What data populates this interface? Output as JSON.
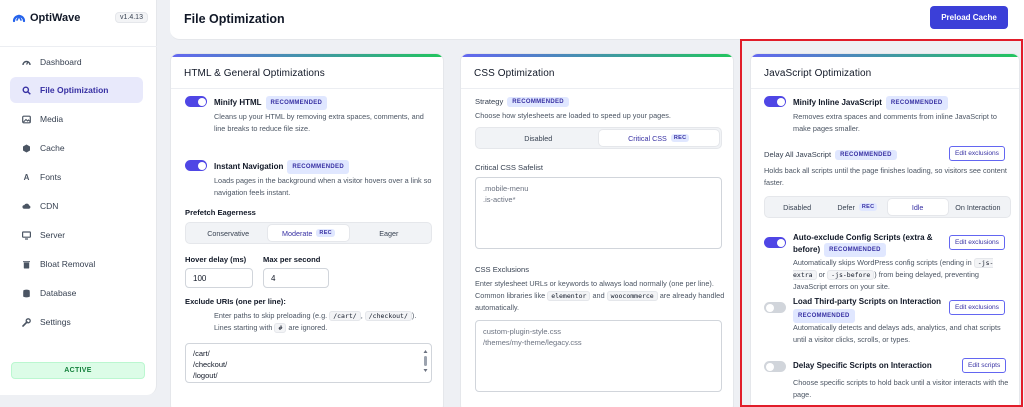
{
  "app": {
    "name": "OptiWave",
    "version": "v1.4.13"
  },
  "sidebar": {
    "items": [
      {
        "label": "Dashboard",
        "icon": "dashboard-icon"
      },
      {
        "label": "File Optimization",
        "icon": "search-icon",
        "active": true
      },
      {
        "label": "Media",
        "icon": "image-icon"
      },
      {
        "label": "Cache",
        "icon": "cache-icon"
      },
      {
        "label": "Fonts",
        "icon": "font-icon"
      },
      {
        "label": "CDN",
        "icon": "cloud-icon"
      },
      {
        "label": "Server",
        "icon": "monitor-icon"
      },
      {
        "label": "Bloat Removal",
        "icon": "trash-icon"
      },
      {
        "label": "Database",
        "icon": "database-icon"
      },
      {
        "label": "Settings",
        "icon": "wrench-icon"
      }
    ],
    "status": "ACTIVE"
  },
  "header": {
    "title": "File Optimization",
    "preload_button": "Preload Cache"
  },
  "html_card": {
    "title": "HTML & General Optimizations",
    "minify": {
      "title": "Minify HTML",
      "badge": "RECOMMENDED",
      "enabled": true,
      "desc": "Cleans up your HTML by removing extra spaces, comments, and line breaks to reduce file size."
    },
    "instant_nav": {
      "title": "Instant Navigation",
      "badge": "RECOMMENDED",
      "enabled": true,
      "desc": "Loads pages in the background when a visitor hovers over a link so navigation feels instant."
    },
    "prefetch": {
      "label": "Prefetch Eagerness",
      "options": [
        "Conservative",
        "Moderate",
        "Eager"
      ],
      "selected": "Moderate",
      "rec_badge": "REC"
    },
    "hover_delay": {
      "label": "Hover delay (ms)",
      "value": "100"
    },
    "max_per_second": {
      "label": "Max per second",
      "value": "4"
    },
    "exclude": {
      "label": "Exclude URIs (one per line):",
      "desc_pre": "Enter paths to skip preloading (e.g.",
      "code1": "/cart/",
      "comma": ",",
      "code2": "/checkout/",
      "desc_mid": "). Lines starting with",
      "code3": "#",
      "desc_post": "are ignored.",
      "value": "/cart/\n/checkout/\n/logout/"
    }
  },
  "css_card": {
    "title": "CSS Optimization",
    "strategy": {
      "label": "Strategy",
      "badge": "RECOMMENDED",
      "desc": "Choose how stylesheets are loaded to speed up your pages.",
      "options": [
        "Disabled",
        "Critical CSS"
      ],
      "selected": "Critical CSS",
      "rec_badge": "REC"
    },
    "safelist": {
      "label": "Critical CSS Safelist",
      "placeholder": ".mobile-menu\n.is-active*"
    },
    "exclusions": {
      "label": "CSS Exclusions",
      "desc_pre": "Enter stylesheet URLs or keywords to always load normally (one per line). Common libraries like",
      "code1": "elementor",
      "and": "and",
      "code2": "woocommerce",
      "desc_post": "are already handled automatically.",
      "placeholder": "custom-plugin-style.css\n/themes/my-theme/legacy.css"
    }
  },
  "js_card": {
    "title": "JavaScript Optimization",
    "minify_inline": {
      "title": "Minify Inline JavaScript",
      "badge": "RECOMMENDED",
      "enabled": true,
      "desc": "Removes extra spaces and comments from inline JavaScript to make pages smaller."
    },
    "delay_all": {
      "title": "Delay All JavaScript",
      "badge": "RECOMMENDED",
      "button": "Edit exclusions",
      "desc": "Holds back all scripts until the page finishes loading, so visitors see content faster.",
      "options": [
        "Disabled",
        "Defer",
        "Idle",
        "On Interaction"
      ],
      "selected": "Idle",
      "rec_badge": "REC"
    },
    "auto_exclude": {
      "title_line1": "Auto-exclude Config Scripts (extra &",
      "title_line2": "before)",
      "badge": "RECOMMENDED",
      "enabled": true,
      "button": "Edit exclusions",
      "desc_pre": "Automatically skips WordPress config scripts (ending in",
      "code1": "-js-extra",
      "or": "or",
      "code2": "-js-before",
      "desc_post": ") from being delayed, preventing JavaScript errors on your site."
    },
    "third_party": {
      "title": "Load Third-party Scripts on Interaction",
      "badge": "RECOMMENDED",
      "enabled": false,
      "button": "Edit exclusions",
      "desc": "Automatically detects and delays ads, analytics, and chat scripts until a visitor clicks, scrolls, or types."
    },
    "delay_specific": {
      "title": "Delay Specific Scripts on Interaction",
      "enabled": false,
      "button": "Edit scripts",
      "desc": "Choose specific scripts to hold back until a visitor interacts with the page."
    }
  },
  "colors": {
    "accent": "#4f46e5",
    "button": "#3b3fd8",
    "highlight": "#e11d2a",
    "success": "#15803d"
  }
}
